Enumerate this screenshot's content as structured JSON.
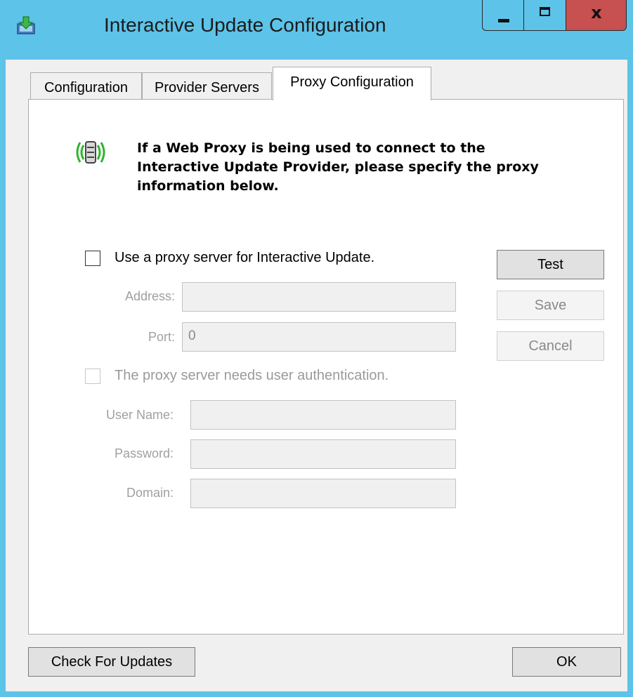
{
  "window": {
    "title": "Interactive Update Configuration",
    "close_glyph": "x"
  },
  "tabs": [
    {
      "label": "Configuration"
    },
    {
      "label": "Provider Servers"
    },
    {
      "label": "Proxy Configuration"
    }
  ],
  "info": {
    "text": "If a Web Proxy is being used to connect to the Interactive Update Provider, please specify the proxy information below."
  },
  "proxy": {
    "use_proxy_label": "Use a proxy server for Interactive Update.",
    "use_proxy_checked": false,
    "address_label": "Address:",
    "address_value": "",
    "port_label": "Port:",
    "port_value": "0"
  },
  "auth": {
    "needs_auth_label": "The proxy server needs user authentication.",
    "needs_auth_checked": false,
    "username_label": "User Name:",
    "username_value": "",
    "password_label": "Password:",
    "password_value": "",
    "domain_label": "Domain:",
    "domain_value": ""
  },
  "buttons": {
    "test": "Test",
    "save": "Save",
    "cancel": "Cancel",
    "check_updates": "Check For Updates",
    "ok": "OK"
  },
  "colors": {
    "titlebar": "#5dc3e9",
    "close_button": "#c75050",
    "signal_green": "#2db52d"
  },
  "icons": {
    "app": "download-icon",
    "info": "wireless-server-icon"
  }
}
